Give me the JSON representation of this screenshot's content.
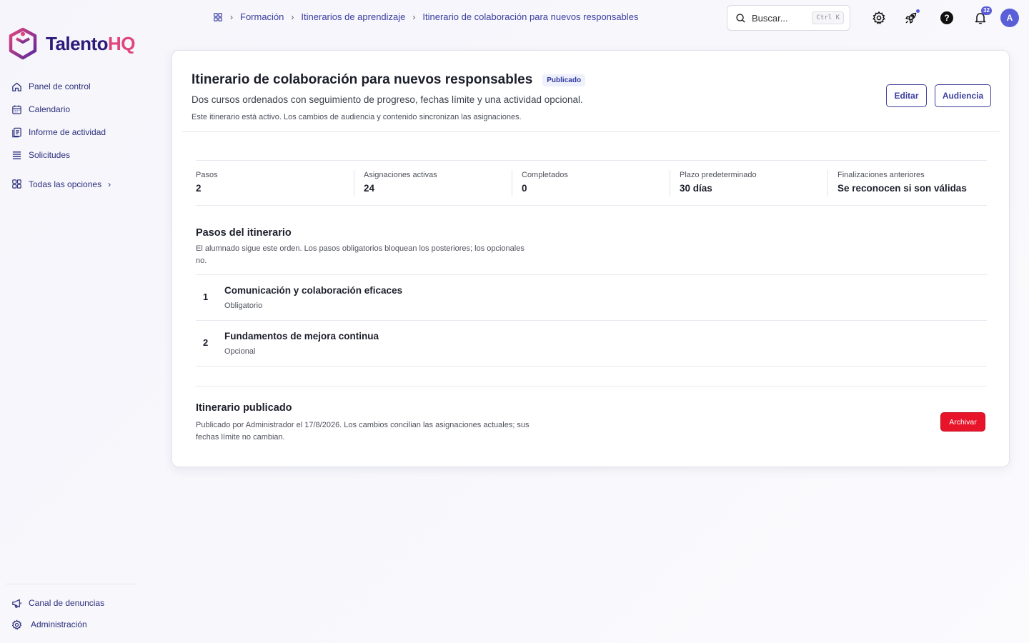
{
  "app": {
    "brand_part1": "Talento",
    "brand_part2": "HQ",
    "brand_colors": {
      "primary": "#2e1a7a",
      "accent": "#e0457b"
    }
  },
  "sidebar": {
    "items": [
      {
        "label": "Panel de control",
        "icon": "home-icon"
      },
      {
        "label": "Calendario",
        "icon": "calendar-icon"
      },
      {
        "label": "Informe de actividad",
        "icon": "report-icon"
      },
      {
        "label": "Solicitudes",
        "icon": "list-icon"
      }
    ],
    "all_options": "Todas las opciones",
    "bottom_items": [
      {
        "label": "Canal de denuncias",
        "icon": "megaphone-icon"
      },
      {
        "label": "Administración",
        "icon": "gear-icon"
      }
    ]
  },
  "breadcrumb": {
    "items": [
      "Formación",
      "Itinerarios de aprendizaje",
      "Itinerario de colaboración para nuevos responsables"
    ]
  },
  "search": {
    "placeholder": "Buscar...",
    "shortcut": "Ctrl K"
  },
  "topbar": {
    "notifications_count": "32",
    "avatar_initial": "A"
  },
  "itinerary": {
    "title": "Itinerario de colaboración para nuevos responsables",
    "status": "Publicado",
    "description": "Dos cursos ordenados con seguimiento de progreso, fechas límite y una actividad opcional.",
    "note": "Este itinerario está activo. Los cambios de audiencia y contenido sincronizan las asignaciones.",
    "edit_label": "Editar",
    "audience_label": "Audiencia"
  },
  "stats": [
    {
      "label": "Pasos",
      "value": "2"
    },
    {
      "label": "Asignaciones activas",
      "value": "24"
    },
    {
      "label": "Completados",
      "value": "0"
    },
    {
      "label": "Plazo predeterminado",
      "value": "30 días"
    },
    {
      "label": "Finalizaciones anteriores",
      "value": "Se reconocen si son válidas"
    }
  ],
  "steps": {
    "title": "Pasos del itinerario",
    "description": "El alumnado sigue este orden. Los pasos obligatorios bloquean los posteriores; los opcionales no.",
    "items": [
      {
        "number": "1",
        "name": "Comunicación y colaboración eficaces",
        "kind": "Obligatorio"
      },
      {
        "number": "2",
        "name": "Fundamentos de mejora continua",
        "kind": "Opcional"
      }
    ]
  },
  "publication": {
    "title": "Itinerario publicado",
    "description": "Publicado por Administrador el 17/8/2026. Los cambios concilian las asignaciones actuales; sus fechas límite no cambian.",
    "archive_label": "Archivar",
    "archive_color": "#e8142a"
  }
}
